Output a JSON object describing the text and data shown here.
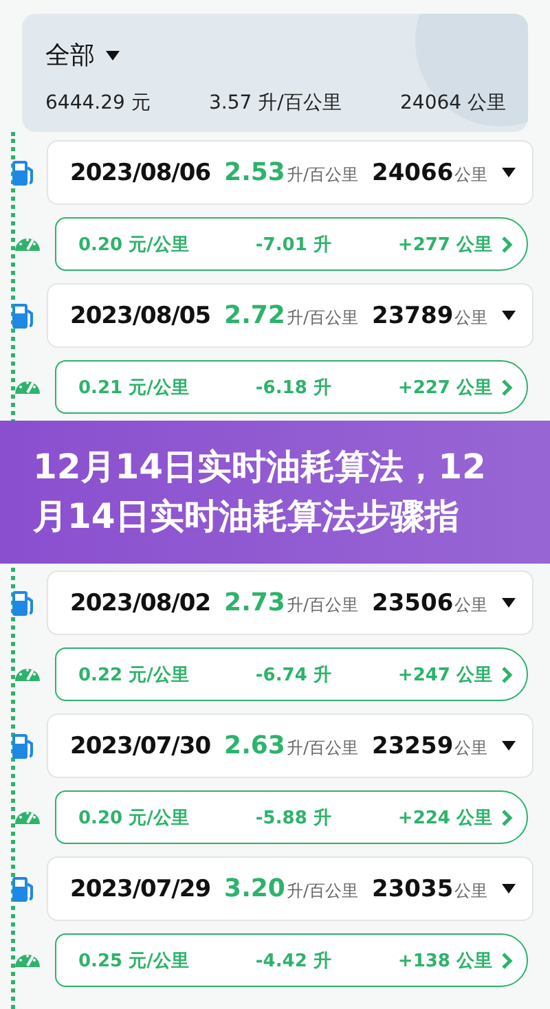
{
  "summary": {
    "filter": "全部",
    "cost": "6444.29 元",
    "consumption": "3.57 升/百公里",
    "distance": "24064 公里"
  },
  "records": [
    {
      "kind": "fill",
      "date": "2023/08/06",
      "rate": "2.53",
      "rate_unit": "升/百公里",
      "odometer": "24066",
      "odometer_unit": "公里"
    },
    {
      "kind": "trip",
      "cost_per_km": "0.20 元/公里",
      "fuel": "-7.01 升",
      "distance": "+277 公里"
    },
    {
      "kind": "fill",
      "date": "2023/08/05",
      "rate": "2.72",
      "rate_unit": "升/百公里",
      "odometer": "23789",
      "odometer_unit": "公里"
    },
    {
      "kind": "trip",
      "cost_per_km": "0.21 元/公里",
      "fuel": "-6.18 升",
      "distance": "+227 公里"
    },
    {
      "kind": "banner",
      "title": "12月14日实时油耗算法，12月14日实时油耗算法步骤指"
    },
    {
      "kind": "fill",
      "date": "2023/08/02",
      "rate": "2.73",
      "rate_unit": "升/百公里",
      "odometer": "23506",
      "odometer_unit": "公里"
    },
    {
      "kind": "trip",
      "cost_per_km": "0.22 元/公里",
      "fuel": "-6.74 升",
      "distance": "+247 公里"
    },
    {
      "kind": "fill",
      "date": "2023/07/30",
      "rate": "2.63",
      "rate_unit": "升/百公里",
      "odometer": "23259",
      "odometer_unit": "公里"
    },
    {
      "kind": "trip",
      "cost_per_km": "0.20 元/公里",
      "fuel": "-5.88 升",
      "distance": "+224 公里"
    },
    {
      "kind": "fill",
      "date": "2023/07/29",
      "rate": "3.20",
      "rate_unit": "升/百公里",
      "odometer": "23035",
      "odometer_unit": "公里"
    },
    {
      "kind": "trip",
      "cost_per_km": "0.25 元/公里",
      "fuel": "-4.42 升",
      "distance": "+138 公里"
    }
  ]
}
